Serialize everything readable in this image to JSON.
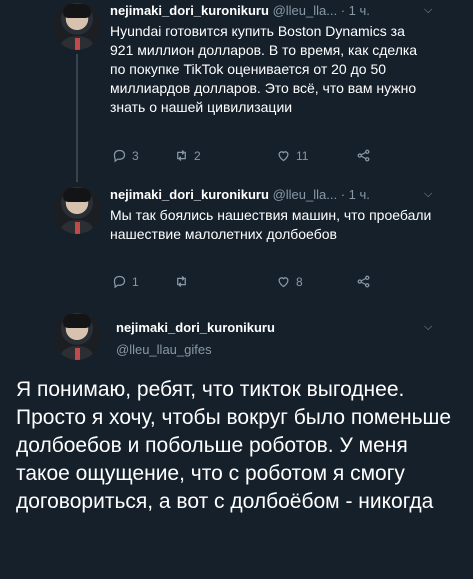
{
  "tweets": [
    {
      "name": "nejimaki_dori_kuronikuru",
      "handle": "@lleu_lla...",
      "time": "· 1 ч.",
      "text": "Hyundai готовится купить Boston Dynamics за 921 миллион долларов. В то время, как сделка по покупке TikTok оценивается от 20 до 50 миллиардов долларов. Это всё, что вам нужно знать о нашей цивилизации",
      "replies": "3",
      "retweets": "2",
      "likes": "11"
    },
    {
      "name": "nejimaki_dori_kuronikuru",
      "handle": "@lleu_lla...",
      "time": "· 1 ч.",
      "text": "Мы так боялись нашествия машин, что проебали нашествие малолетних долбоебов",
      "replies": "1",
      "retweets": "",
      "likes": "8"
    }
  ],
  "main_tweet": {
    "name": "nejimaki_dori_kuronikuru",
    "handle": "@lleu_llau_gifes",
    "text": "Я понимаю, ребят, что тикток выгоднее. Просто я хочу, чтобы вокруг было поменьше долбоебов и побольше роботов. У меня такое ощущение, что с роботом я смогу договориться, а вот с долбоёбом - никогда"
  },
  "icons": {
    "reply": "reply-icon",
    "retweet": "retweet-icon",
    "like": "heart-icon",
    "share": "share-icon",
    "more": "chevron-down-icon"
  },
  "colors": {
    "background": "#15202b",
    "muted": "#8899a6",
    "text": "#ffffff",
    "thread_line": "#38444d"
  }
}
